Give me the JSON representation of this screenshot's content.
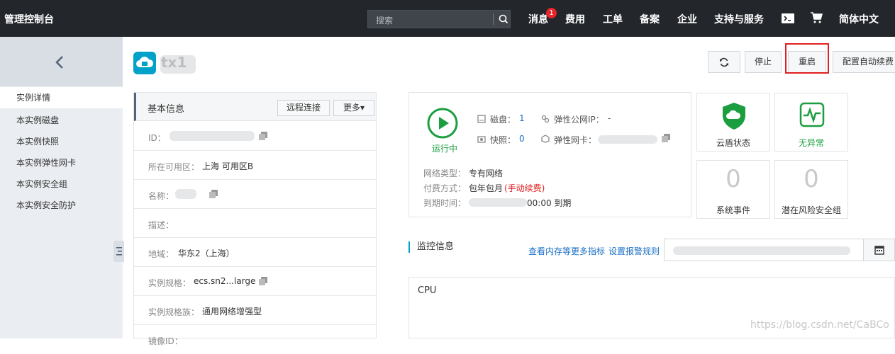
{
  "topbar": {
    "logo": "管理控制台",
    "search_placeholder": "搜索",
    "nav": [
      "消息",
      "费用",
      "工单",
      "备案",
      "企业",
      "支持与服务",
      "简体中文"
    ],
    "message_badge": "1"
  },
  "sidebar": {
    "items": [
      "实例详情",
      "本实例磁盘",
      "本实例快照",
      "本实例弹性网卡",
      "本实例安全组",
      "本实例安全防护"
    ]
  },
  "header": {
    "title": "tx1",
    "buttons": {
      "stop": "停止",
      "restart": "重启",
      "auto_renew": "配置自动续费"
    }
  },
  "info": {
    "title": "基本信息",
    "remote": "远程连接",
    "more": "更多▾",
    "rows": [
      {
        "k": "ID：",
        "v": ""
      },
      {
        "k": "所在可用区：",
        "v": "上海 可用区B"
      },
      {
        "k": "名称：",
        "v": ""
      },
      {
        "k": "描述：",
        "v": ""
      },
      {
        "k": "地域：",
        "v": "华东2（上海）"
      },
      {
        "k": "实例规格：",
        "v": "ecs.sn2...large"
      },
      {
        "k": "实例规格族：",
        "v": "通用网络增强型"
      },
      {
        "k": "镜像ID：",
        "v": ""
      }
    ]
  },
  "status": {
    "state": "运行中",
    "disk_label": "磁盘：",
    "disk_value": "1",
    "snapshot_label": "快照：",
    "snapshot_value": "0",
    "eip_label": "弹性公网IP：",
    "eip_value": "-",
    "eni_label": "弹性网卡：",
    "net_label": "网络类型：",
    "net_value": "专有网络",
    "pay_label": "付费方式：",
    "pay_value": "包年包月",
    "pay_note": "(手动续费)",
    "expire_label": "到期时间：",
    "expire_value": "00:00 到期"
  },
  "cards": {
    "shield": "云盾状态",
    "health": "无异常",
    "events_count": "0",
    "events": "系统事件",
    "risk_count": "0",
    "risk": "潜在风险安全组"
  },
  "monitor": {
    "title": "监控信息",
    "link1": "查看内存等更多指标",
    "link2": "设置报警规则",
    "cpu": "CPU"
  },
  "watermark": "https://blog.csdn.net/CaBCo",
  "colors": {
    "accent": "#00a2ca",
    "green": "#1a9e3f",
    "red": "#e02020",
    "link": "#1a6fc4"
  }
}
